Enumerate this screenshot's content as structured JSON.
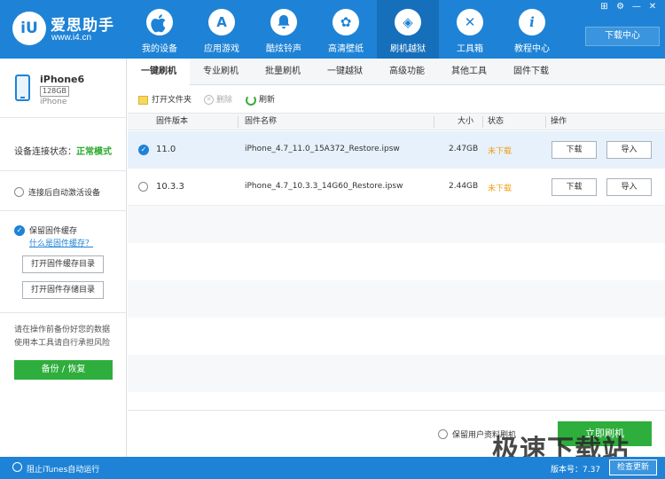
{
  "app": {
    "brand": "爱思助手",
    "logo_text": "iU",
    "url": "www.i4.cn",
    "download_center": "下载中心"
  },
  "window_controls": [
    "⊞",
    "⚙",
    "—",
    "✕"
  ],
  "nav": [
    {
      "label": "我的设备",
      "icon": "apple-icon",
      "glyph": ""
    },
    {
      "label": "应用游戏",
      "icon": "appstore-icon",
      "glyph": "A"
    },
    {
      "label": "酷炫铃声",
      "icon": "bell-icon",
      "glyph": "♪"
    },
    {
      "label": "高清壁纸",
      "icon": "flower-icon",
      "glyph": "✿"
    },
    {
      "label": "刷机越狱",
      "icon": "dropbox-icon",
      "glyph": "◈"
    },
    {
      "label": "工具箱",
      "icon": "tools-icon",
      "glyph": "✕"
    },
    {
      "label": "教程中心",
      "icon": "info-icon",
      "glyph": "i"
    }
  ],
  "device": {
    "name": "iPhone6",
    "capacity": "128GB",
    "model": "iPhone"
  },
  "sidebar": {
    "connection_label": "设备连接状态：",
    "connection_status": "正常模式",
    "auto_activate": "连接后自动激活设备",
    "keep_cache": "保留固件缓存",
    "what_is_cache": "什么是固件缓存？",
    "open_cache_dir": "打开固件缓存目录",
    "open_storage_dir": "打开固件存储目录",
    "warning_line1": "请在操作前备份好您的数据",
    "warning_line2": "使用本工具请自行承担风险",
    "backup_button": "备份 / 恢复"
  },
  "subtabs": [
    "一键刷机",
    "专业刷机",
    "批量刷机",
    "一键越狱",
    "高级功能",
    "其他工具",
    "固件下载"
  ],
  "toolbar": {
    "open_folder": "打开文件夹",
    "delete": "删除",
    "refresh": "刷新"
  },
  "table": {
    "headers": {
      "version": "固件版本",
      "name": "固件名称",
      "size": "大小",
      "status": "状态",
      "actions": "操作"
    },
    "rows": [
      {
        "version": "11.0",
        "name": "iPhone_4.7_11.0_15A372_Restore.ipsw",
        "size": "2.47GB",
        "status": "未下载",
        "download": "下载",
        "import": "导入",
        "selected": true
      },
      {
        "version": "10.3.3",
        "name": "iPhone_4.7_10.3.3_14G60_Restore.ipsw",
        "size": "2.44GB",
        "status": "未下载",
        "download": "下载",
        "import": "导入",
        "selected": false
      }
    ]
  },
  "bottom": {
    "keep_user_data": "保留用户资料刷机",
    "flash_button": "立即刷机",
    "watermark": "极速下载站"
  },
  "statusbar": {
    "block_itunes": "阻止iTunes自动运行",
    "version": "版本号：7.37",
    "check_update": "检查更新"
  }
}
